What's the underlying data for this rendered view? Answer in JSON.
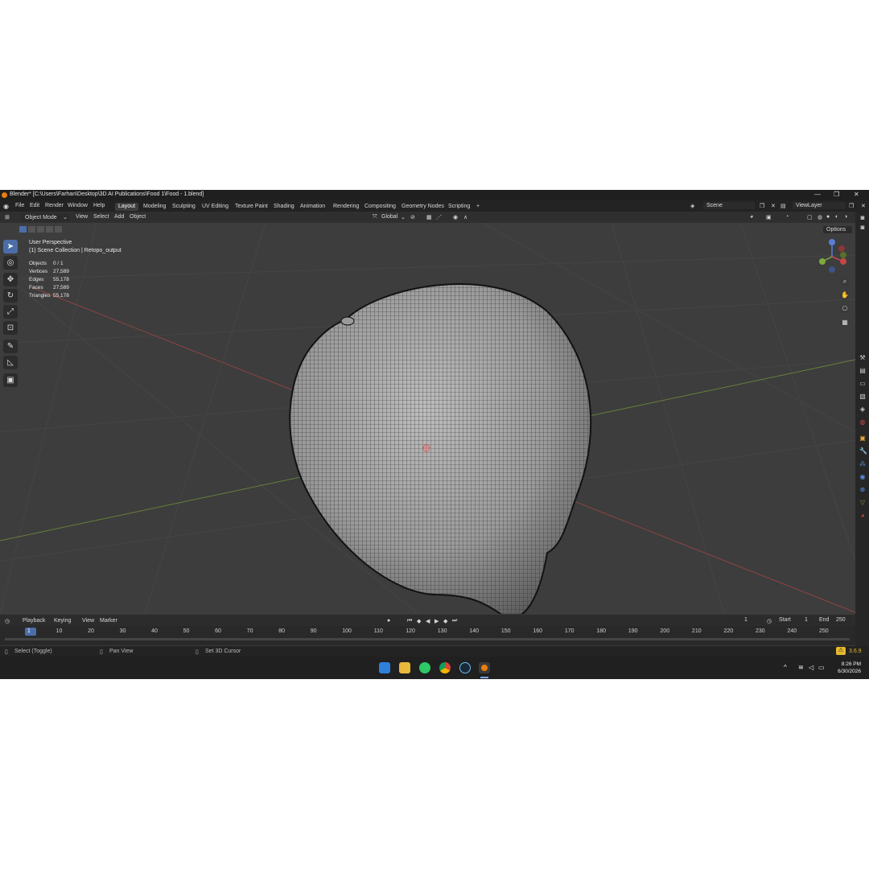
{
  "window": {
    "title": "Blender* [C:\\Users\\Farhan\\Desktop\\3D AI Publications\\Food 1\\Food - 1.blend]",
    "minimize": "—",
    "maximize": "❐",
    "close": "✕"
  },
  "menu": [
    "File",
    "Edit",
    "Render",
    "Window",
    "Help"
  ],
  "workspaces": [
    "Layout",
    "Modeling",
    "Sculpting",
    "UV Editing",
    "Texture Paint",
    "Shading",
    "Animation",
    "Rendering",
    "Compositing",
    "Geometry Nodes",
    "Scripting",
    "+"
  ],
  "scene_field": "Scene",
  "viewlayer_field": "ViewLayer",
  "header": {
    "mode": "Object Mode",
    "view": "View",
    "select": "Select",
    "add": "Add",
    "object": "Object",
    "orientation": "Global",
    "options": "Options"
  },
  "overlay_info": {
    "perspective": "User Perspective",
    "collection": "(1) Scene Collection | Retopo_output"
  },
  "stats": [
    {
      "label": "Objects",
      "value": "0 / 1"
    },
    {
      "label": "Vertices",
      "value": "27,589"
    },
    {
      "label": "Edges",
      "value": "55,178"
    },
    {
      "label": "Faces",
      "value": "27,589"
    },
    {
      "label": "Triangles",
      "value": "55,178"
    }
  ],
  "timeline": {
    "playback": "Playback",
    "keying": "Keying",
    "view": "View",
    "marker": "Marker",
    "current_frame": "1",
    "start_label": "Start",
    "start": "1",
    "end_label": "End",
    "end": "250",
    "frames": [
      "1",
      "10",
      "20",
      "30",
      "40",
      "50",
      "60",
      "70",
      "80",
      "90",
      "100",
      "110",
      "120",
      "130",
      "140",
      "150",
      "160",
      "170",
      "180",
      "190",
      "200",
      "210",
      "220",
      "230",
      "240",
      "250"
    ]
  },
  "status": {
    "select": "Select (Toggle)",
    "pan": "Pan View",
    "cursor": "Set 3D Cursor",
    "version": "3.6.9"
  },
  "taskbar": {
    "time": "8:26 PM",
    "date": "6/30/2026"
  },
  "colors": {
    "accent": "#4b6ea8",
    "x_axis": "#c44747",
    "y_axis": "#7ea83a",
    "logo": "#e87d0d",
    "warning": "#e6b72e"
  }
}
